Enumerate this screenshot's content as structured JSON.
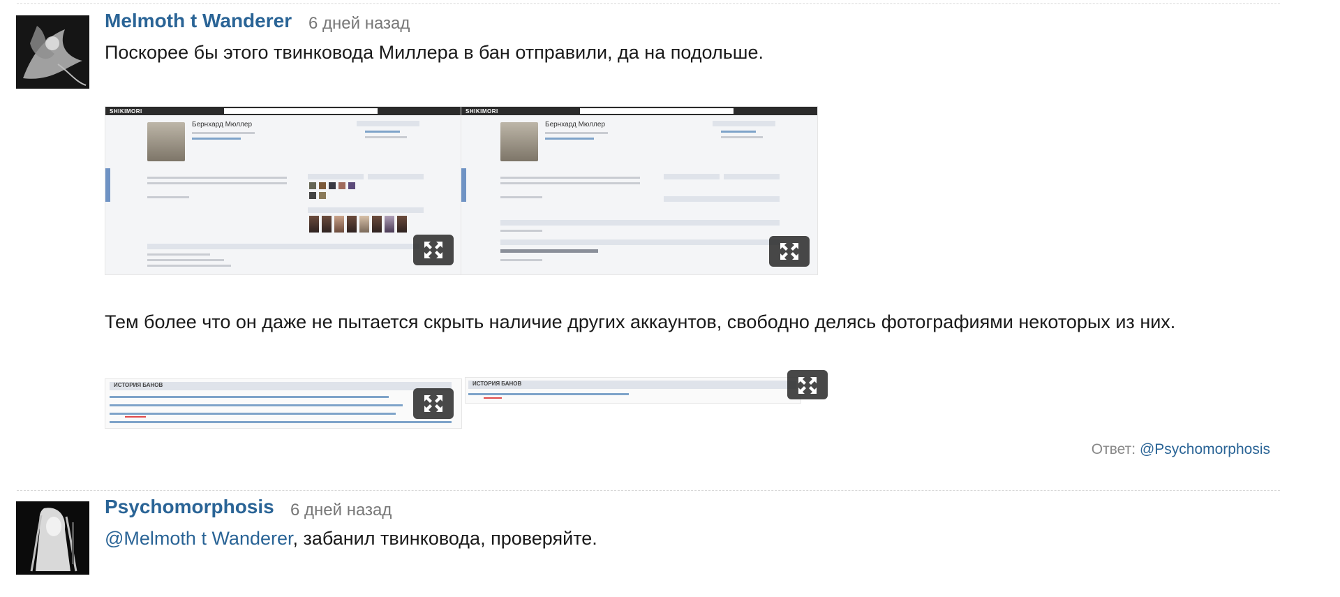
{
  "comments": [
    {
      "author": "Melmoth t Wanderer",
      "time": "6 дней назад",
      "text1": "Поскорее бы этого твинковода Миллера в бан отправили, да на подольше.",
      "text2": "Тем более что он даже не пытается скрыть наличие других аккаунтов, свободно делясь фотографиями некоторых из них.",
      "reply_prefix": "Ответ: ",
      "reply_link": "@Psychomorphosis",
      "screenshots": {
        "profile_left": {
          "brand": "SHIKIMORI",
          "name": "Бернхард Мюллер"
        },
        "profile_right": {
          "brand": "SHIKIMORI",
          "name": "Бернхард Мюллер"
        },
        "ban_left": {
          "header": "ИСТОРИЯ БАНОВ"
        },
        "ban_right": {
          "header": "ИСТОРИЯ БАНОВ"
        }
      }
    },
    {
      "author": "Psychomorphosis",
      "time": "6 дней назад",
      "mention": "@Melmoth t Wanderer",
      "text_rest": ", забанил твинковода, проверяйте."
    }
  ],
  "icons": {
    "expand": "expand-icon",
    "avatar1": "avatar-illustration",
    "avatar2": "avatar-photo"
  },
  "colors": {
    "link": "#2a6496",
    "meta": "#777777",
    "divider": "#d7d7d7"
  }
}
